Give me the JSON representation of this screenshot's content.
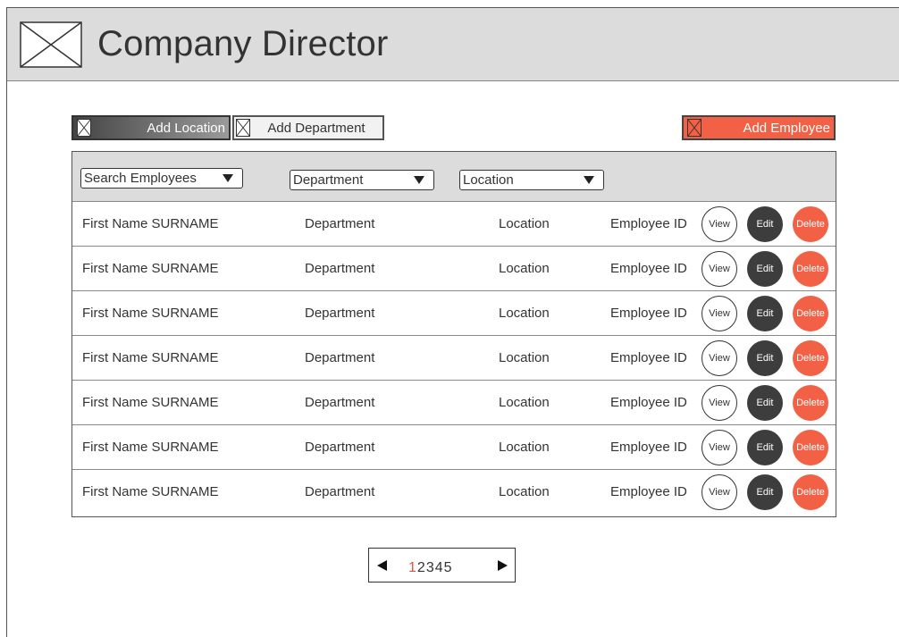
{
  "header": {
    "title": "Company Director",
    "logo_icon": "image-placeholder-icon"
  },
  "toolbar": {
    "add_location": "Add Location",
    "add_department": "Add Department",
    "add_employee": "Add Employee"
  },
  "filters": {
    "search": "Search Employees",
    "department": "Department",
    "location": "Location"
  },
  "actions": {
    "view": "View",
    "edit": "Edit",
    "delete": "Delete"
  },
  "rows": [
    {
      "name": "First Name SURNAME",
      "department": "Department",
      "location": "Location",
      "employee_id": "Employee ID"
    },
    {
      "name": "First Name SURNAME",
      "department": "Department",
      "location": "Location",
      "employee_id": "Employee ID"
    },
    {
      "name": "First Name SURNAME",
      "department": "Department",
      "location": "Location",
      "employee_id": "Employee ID"
    },
    {
      "name": "First Name SURNAME",
      "department": "Department",
      "location": "Location",
      "employee_id": "Employee ID"
    },
    {
      "name": "First Name SURNAME",
      "department": "Department",
      "location": "Location",
      "employee_id": "Employee ID"
    },
    {
      "name": "First Name SURNAME",
      "department": "Department",
      "location": "Location",
      "employee_id": "Employee ID"
    },
    {
      "name": "First Name SURNAME",
      "department": "Department",
      "location": "Location",
      "employee_id": "Employee ID"
    }
  ],
  "pagination": {
    "pages": [
      "1",
      "2",
      "3",
      "4",
      "5"
    ],
    "current": "1"
  },
  "colors": {
    "accent": "#f26045",
    "dark_button": "#3d3d3d",
    "header_bg": "#dcdcdc"
  }
}
